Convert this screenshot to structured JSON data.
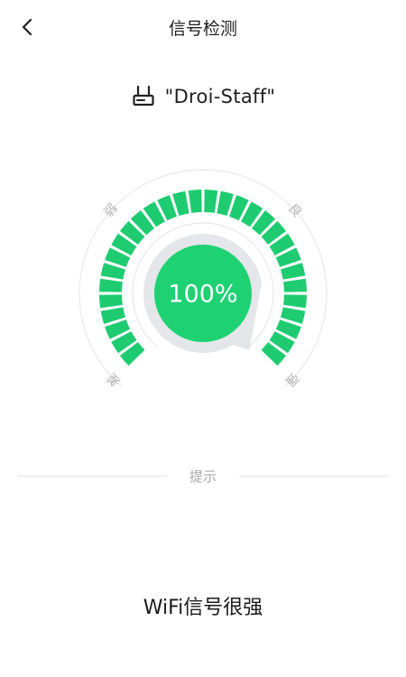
{
  "header": {
    "title": "信号检测",
    "back_icon": "chevron-left-icon"
  },
  "network": {
    "icon": "router-icon",
    "name": "\"Droi-Staff\""
  },
  "gauge": {
    "percent_label": "100%",
    "signal_fraction": 1.0,
    "segment_count": 30,
    "labels": {
      "poor": "差",
      "weak": "弱",
      "good": "良",
      "strong": "强"
    },
    "colors": {
      "active": "#1ecb71",
      "center": "#1ed273",
      "ring": "#e4e6ea",
      "track": "#e8e8e8",
      "label": "#b3b3b3"
    }
  },
  "tips": {
    "label": "提示"
  },
  "status": {
    "text": "WiFi信号很强"
  }
}
